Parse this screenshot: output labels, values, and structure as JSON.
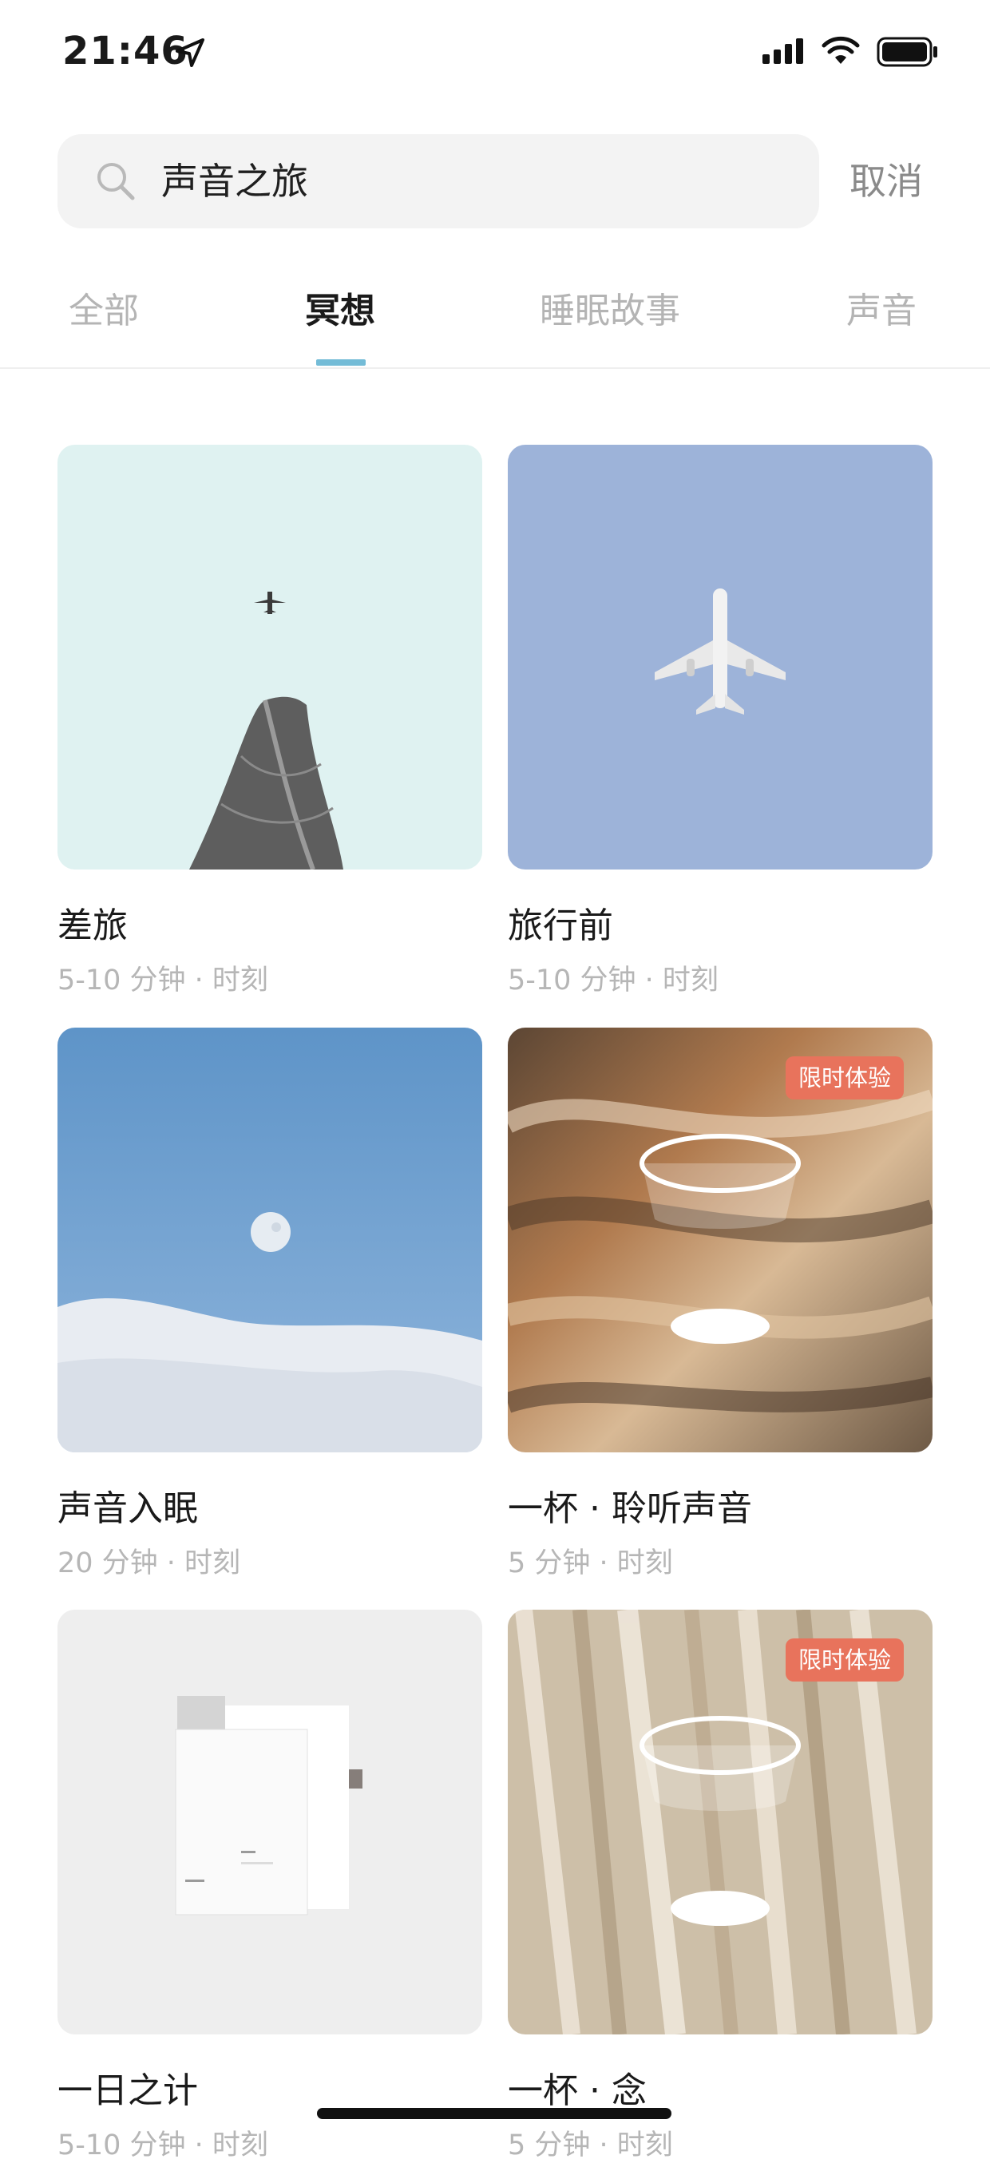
{
  "status_bar": {
    "time": "21:46"
  },
  "search": {
    "query": "声音之旅",
    "cancel_label": "取消"
  },
  "tabs": [
    {
      "label": "全部"
    },
    {
      "label": "冥想"
    },
    {
      "label": "睡眠故事"
    },
    {
      "label": "声音"
    }
  ],
  "active_tab": "冥想",
  "cards": [
    {
      "title": "差旅",
      "meta": "5-10 分钟 · 时刻"
    },
    {
      "title": "旅行前",
      "meta": "5-10 分钟 · 时刻"
    },
    {
      "title": "声音入眠",
      "meta": "20 分钟 · 时刻"
    },
    {
      "title": "一杯 · 聆听声音",
      "meta": "5 分钟 · 时刻",
      "badge": "限时体验"
    },
    {
      "title": "一日之计",
      "meta": "5-10 分钟 · 时刻"
    },
    {
      "title": "一杯 · 念",
      "meta": "5 分钟 · 时刻",
      "badge": "限时体验"
    }
  ],
  "colors": {
    "accent": "#74bcd7",
    "badge": "#e8735c"
  },
  "icons": [
    "location-arrow-icon",
    "signal-icon",
    "wifi-icon",
    "battery-icon",
    "search-icon"
  ]
}
